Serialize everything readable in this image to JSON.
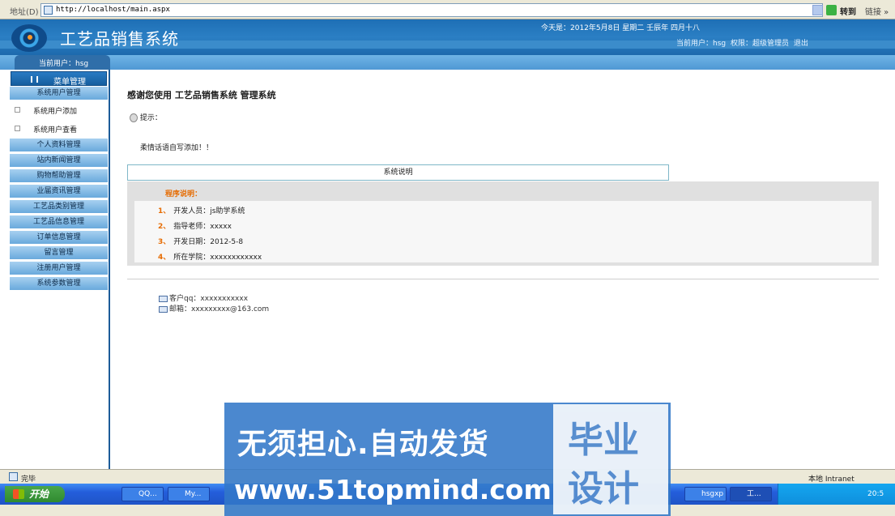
{
  "address_bar": {
    "label": "地址(D)",
    "url": "http://localhost/main.aspx",
    "go_label": "转到",
    "links_label": "链接 »"
  },
  "header": {
    "title": "工艺品销售系统",
    "date": "今天是：2012年5月8日 星期二 壬辰年 四月十八",
    "user_label": "当前用户：hsg",
    "permission": "权限：超级管理员",
    "logout": "退出",
    "sidebar_user": "当前用户：hsg"
  },
  "sidebar": {
    "menu_title": "菜单管理",
    "items": [
      {
        "label": "系统用户管理",
        "type": "group"
      },
      {
        "label": "系统用户添加",
        "type": "sub"
      },
      {
        "label": "系统用户查看",
        "type": "sub"
      },
      {
        "label": "个人资料管理",
        "type": "group"
      },
      {
        "label": "站内新闻管理",
        "type": "group"
      },
      {
        "label": "购物帮助管理",
        "type": "group"
      },
      {
        "label": "业届资讯管理",
        "type": "group"
      },
      {
        "label": "工艺品类别管理",
        "type": "group"
      },
      {
        "label": "工艺品信息管理",
        "type": "group"
      },
      {
        "label": "订单信息管理",
        "type": "group"
      },
      {
        "label": "留言管理",
        "type": "group"
      },
      {
        "label": "注册用户管理",
        "type": "group"
      },
      {
        "label": "系统参数管理",
        "type": "group"
      }
    ]
  },
  "main": {
    "welcome": "感谢您使用 工艺品销售系统 管理系统",
    "tip": "提示：",
    "note": "柔情话语自写添加！！",
    "tab": "系统说明",
    "panel_title": "程序说明：",
    "rows": [
      {
        "num": "1、",
        "text": "开发人员：js助学系统"
      },
      {
        "num": "2、",
        "text": "指导老师：xxxxx"
      },
      {
        "num": "3、",
        "text": "开发日期：2012-5-8"
      },
      {
        "num": "4、",
        "text": "所在学院：xxxxxxxxxxxx"
      }
    ],
    "qq": "客户qq：xxxxxxxxxxx",
    "email": "邮箱：xxxxxxxxx@163.com"
  },
  "status_bar": {
    "left": "完毕",
    "zone": "本地 Intranet"
  },
  "taskbar": {
    "start": "开始",
    "buttons": [
      "QQ...",
      "My...",
      "hsgxp",
      "工..."
    ],
    "clock": "20:5"
  },
  "watermark": {
    "line1": "无须担心.自动发货",
    "line2": "www.51topmind.com",
    "box1": "毕业",
    "box2": "设计"
  },
  "colors": {
    "header_blue": "#1e6fb5",
    "menu_blue": "#69a9dc",
    "accent_orange": "#e66b00"
  }
}
